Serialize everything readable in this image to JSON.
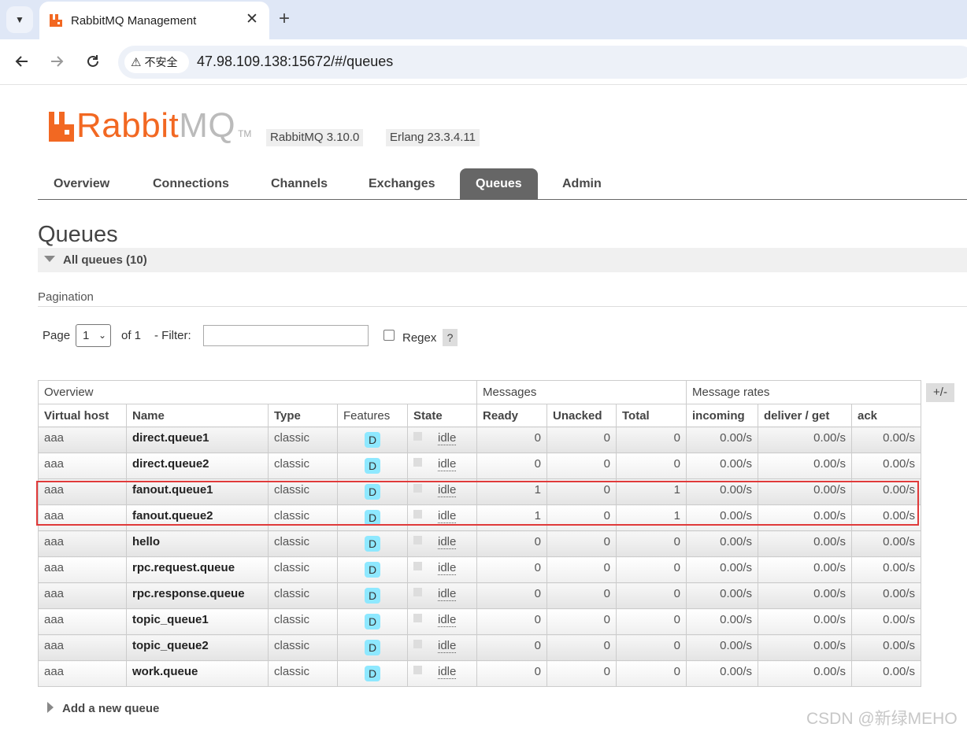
{
  "browser": {
    "tab_title": "RabbitMQ Management",
    "close_glyph": "✕",
    "new_tab_glyph": "+",
    "security_label": "不安全",
    "url": "47.98.109.138:15672/#/queues"
  },
  "header": {
    "logo_text_primary": "Rabbit",
    "logo_text_secondary": "MQ",
    "logo_tm": "TM",
    "rabbitmq_version": "RabbitMQ 3.10.0",
    "erlang_version": "Erlang 23.3.4.11"
  },
  "nav": [
    "Overview",
    "Connections",
    "Channels",
    "Exchanges",
    "Queues",
    "Admin"
  ],
  "page": {
    "title": "Queues",
    "section_label": "All queues (10)",
    "pagination_label": "Pagination",
    "page_label": "Page",
    "page_value": "1",
    "of_label": "of 1",
    "filter_label": "- Filter:",
    "filter_value": "",
    "regex_label": "Regex",
    "help_label": "?",
    "add_queue_label": "Add a new queue",
    "columns_toggle": "+/-"
  },
  "table": {
    "group_headers": [
      "Overview",
      "Messages",
      "Message rates"
    ],
    "columns": [
      "Virtual host",
      "Name",
      "Type",
      "Features",
      "State",
      "Ready",
      "Unacked",
      "Total",
      "incoming",
      "deliver / get",
      "ack"
    ],
    "rows": [
      {
        "vhost": "aaa",
        "name": "direct.queue1",
        "type": "classic",
        "feature": "D",
        "state": "idle",
        "ready": "0",
        "unacked": "0",
        "total": "0",
        "incoming": "0.00/s",
        "deliver": "0.00/s",
        "ack": "0.00/s"
      },
      {
        "vhost": "aaa",
        "name": "direct.queue2",
        "type": "classic",
        "feature": "D",
        "state": "idle",
        "ready": "0",
        "unacked": "0",
        "total": "0",
        "incoming": "0.00/s",
        "deliver": "0.00/s",
        "ack": "0.00/s"
      },
      {
        "vhost": "aaa",
        "name": "fanout.queue1",
        "type": "classic",
        "feature": "D",
        "state": "idle",
        "ready": "1",
        "unacked": "0",
        "total": "1",
        "incoming": "0.00/s",
        "deliver": "0.00/s",
        "ack": "0.00/s"
      },
      {
        "vhost": "aaa",
        "name": "fanout.queue2",
        "type": "classic",
        "feature": "D",
        "state": "idle",
        "ready": "1",
        "unacked": "0",
        "total": "1",
        "incoming": "0.00/s",
        "deliver": "0.00/s",
        "ack": "0.00/s"
      },
      {
        "vhost": "aaa",
        "name": "hello",
        "type": "classic",
        "feature": "D",
        "state": "idle",
        "ready": "0",
        "unacked": "0",
        "total": "0",
        "incoming": "0.00/s",
        "deliver": "0.00/s",
        "ack": "0.00/s"
      },
      {
        "vhost": "aaa",
        "name": "rpc.request.queue",
        "type": "classic",
        "feature": "D",
        "state": "idle",
        "ready": "0",
        "unacked": "0",
        "total": "0",
        "incoming": "0.00/s",
        "deliver": "0.00/s",
        "ack": "0.00/s"
      },
      {
        "vhost": "aaa",
        "name": "rpc.response.queue",
        "type": "classic",
        "feature": "D",
        "state": "idle",
        "ready": "0",
        "unacked": "0",
        "total": "0",
        "incoming": "0.00/s",
        "deliver": "0.00/s",
        "ack": "0.00/s"
      },
      {
        "vhost": "aaa",
        "name": "topic_queue1",
        "type": "classic",
        "feature": "D",
        "state": "idle",
        "ready": "0",
        "unacked": "0",
        "total": "0",
        "incoming": "0.00/s",
        "deliver": "0.00/s",
        "ack": "0.00/s"
      },
      {
        "vhost": "aaa",
        "name": "topic_queue2",
        "type": "classic",
        "feature": "D",
        "state": "idle",
        "ready": "0",
        "unacked": "0",
        "total": "0",
        "incoming": "0.00/s",
        "deliver": "0.00/s",
        "ack": "0.00/s"
      },
      {
        "vhost": "aaa",
        "name": "work.queue",
        "type": "classic",
        "feature": "D",
        "state": "idle",
        "ready": "0",
        "unacked": "0",
        "total": "0",
        "incoming": "0.00/s",
        "deliver": "0.00/s",
        "ack": "0.00/s"
      }
    ]
  },
  "watermark": "CSDN @新绿MEHO",
  "colors": {
    "brand_orange": "#f26822",
    "active_tab": "#666666",
    "feature_badge": "#8ee8ff",
    "highlight_box": "#e03a3a"
  }
}
